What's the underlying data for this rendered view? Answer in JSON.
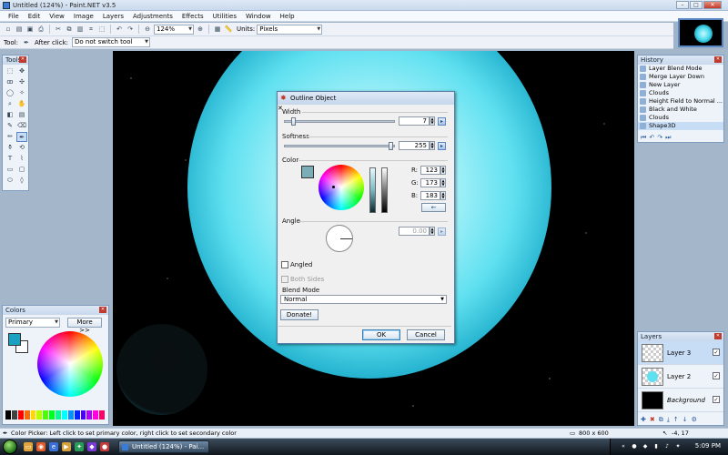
{
  "window": {
    "title": "Untitled (124%) - Paint.NET v3.5"
  },
  "menu": [
    "File",
    "Edit",
    "View",
    "Image",
    "Layers",
    "Adjustments",
    "Effects",
    "Utilities",
    "Window",
    "Help"
  ],
  "toolbar": {
    "zoom": "124%",
    "units_label": "Units:",
    "units_value": "Pixels",
    "tool_label": "Tool:",
    "after_click_label": "After click:",
    "after_click_value": "Do not switch tool"
  },
  "panels": {
    "tools_title": "Tools",
    "colors_title": "Colors",
    "colors_mode": "Primary",
    "colors_more": "More >>",
    "history_title": "History",
    "history_items": [
      "Layer Blend Mode",
      "Merge Layer Down",
      "New Layer",
      "Clouds",
      "Height Field to Normal ...",
      "Black and White",
      "Clouds",
      "Shape3D"
    ],
    "layers_title": "Layers",
    "layers": [
      {
        "name": "Layer 3",
        "check": "✓"
      },
      {
        "name": "Layer 2",
        "check": "✓"
      },
      {
        "name": "Background",
        "check": "✓"
      }
    ]
  },
  "dialog": {
    "title": "Outline Object",
    "width_label": "Width",
    "width_value": "7",
    "width_fraction": 0.07,
    "softness_label": "Softness",
    "softness_value": "255",
    "softness_fraction": 1.0,
    "color_label": "Color",
    "r_label": "R:",
    "r_value": "123",
    "g_label": "G:",
    "g_value": "173",
    "b_label": "B:",
    "b_value": "183",
    "angle_label": "Angle",
    "angle_value": "0.00",
    "angled_label": "Angled",
    "both_sides_label": "Both Sides",
    "blend_mode_label": "Blend Mode",
    "blend_mode_value": "Normal",
    "donate_label": "Donate!",
    "ok_label": "OK",
    "cancel_label": "Cancel",
    "swatch_color": "#7badb7"
  },
  "status": {
    "hint": "Color Picker: Left click to set primary color, right click to set secondary color",
    "size": "800 x 600",
    "coords": "-4, 17"
  },
  "taskbar": {
    "task_label": "Untitled (124%) - Pai...",
    "clock": "5:09 PM"
  },
  "colors": {
    "primary": "#1aa0c0",
    "accent": "#5b86c4"
  }
}
